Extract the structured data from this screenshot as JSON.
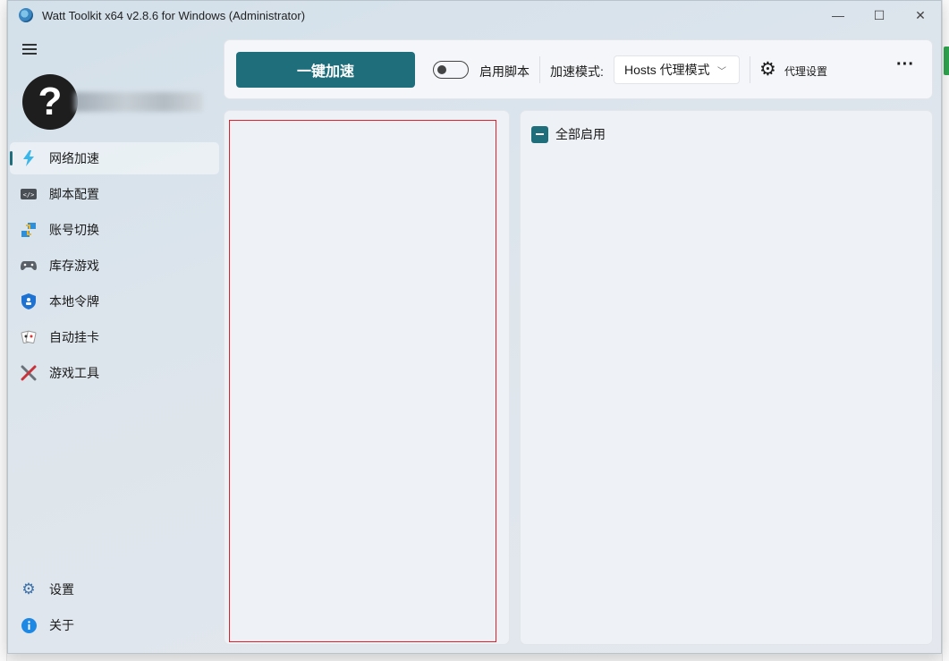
{
  "window": {
    "title": "Watt Toolkit x64 v2.8.6 for Windows (Administrator)",
    "controls": {
      "minimize": "—",
      "maximize": "☐",
      "close": "✕"
    }
  },
  "sidebar": {
    "avatar_char": "?",
    "items": [
      {
        "label": "网络加速",
        "icon": "lightning-icon",
        "active": true
      },
      {
        "label": "脚本配置",
        "icon": "script-icon",
        "active": false
      },
      {
        "label": "账号切换",
        "icon": "account-switch-icon",
        "active": false
      },
      {
        "label": "库存游戏",
        "icon": "gamepad-icon",
        "active": false
      },
      {
        "label": "本地令牌",
        "icon": "shield-icon",
        "active": false
      },
      {
        "label": "自动挂卡",
        "icon": "cards-icon",
        "active": false
      },
      {
        "label": "游戏工具",
        "icon": "tools-icon",
        "active": false
      }
    ],
    "bottom_items": [
      {
        "label": "设置",
        "icon": "gear-icon"
      },
      {
        "label": "关于",
        "icon": "info-icon"
      }
    ]
  },
  "toolbar": {
    "accelerate_label": "一键加速",
    "script_toggle_label": "启用脚本",
    "script_toggle_on": false,
    "mode_label": "加速模式:",
    "mode_value": "Hosts 代理模式",
    "proxy_settings_label": "代理设置",
    "more_label": "···"
  },
  "right_panel": {
    "enable_all_label": "全部启用"
  },
  "colors": {
    "accent": "#1f6e7b",
    "outline_red": "#e0202a"
  }
}
